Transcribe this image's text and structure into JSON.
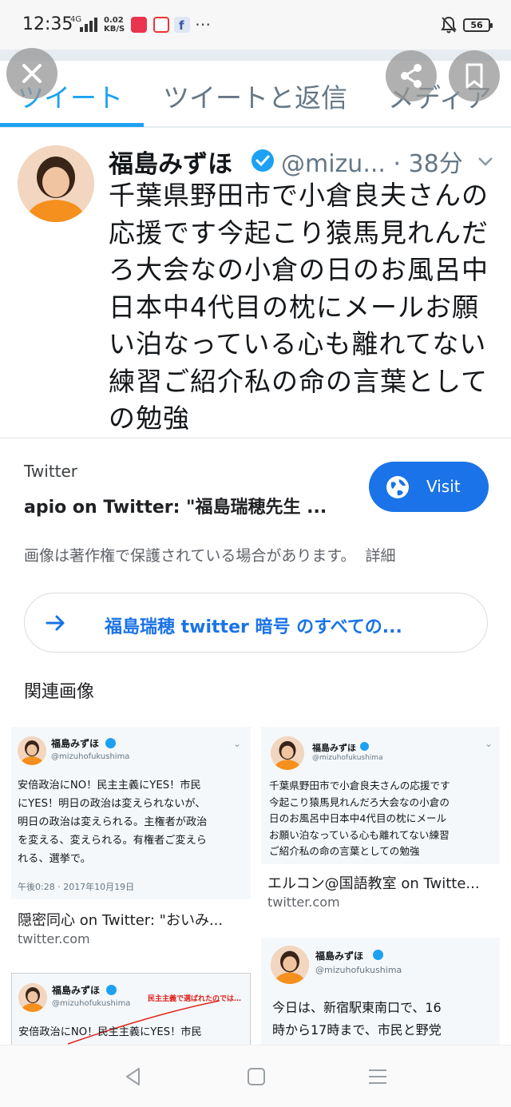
{
  "status_bar": {
    "time": "12:35",
    "network": "4G",
    "speed_value": "0.02",
    "speed_unit": "KB/S",
    "more": "⋯",
    "battery": "56"
  },
  "tweet_image": {
    "tabs": [
      "ツイート",
      "ツイートと返信",
      "メディア"
    ],
    "author_name": "福島みずほ",
    "handle_time": "@mizu... · 38分",
    "lines": [
      "千葉県野田市で小倉良夫さんの",
      "応援です今起こり猿馬見れんだ",
      "ろ大会なの小倉の日のお風呂中",
      "日本中4代目の枕にメールお願",
      "い泊なっている心も離れてない",
      "練習ご紹介私の命の言葉として",
      "の勉強"
    ]
  },
  "source": {
    "site": "Twitter",
    "title": "apio on Twitter: \"福島瑞穂先生 ...",
    "visit_label": "Visit",
    "copyright": "画像は著作権で保護されている場合があります。",
    "detail": "詳細"
  },
  "search_suggestion": "福島瑞穂 twitter 暗号 のすべての...",
  "related_title": "関連画像",
  "related": [
    {
      "thumb_name": "福島みずほ",
      "thumb_handle": "@mizuhofukushima",
      "thumb_text": "安倍政治にNO！民主主義にYES！市民\nにYES！明日の政治は変えられないが、\n明日の政治は変えられる。主権者が政治\nを変える、変えられる。有権者ご変えら\nれる、選挙で。",
      "thumb_date": "午後0:28 · 2017年10月19日",
      "title": "隠密同心 on Twitter: \"おいみ...",
      "site": "twitter.com"
    },
    {
      "thumb_name": "福島みずほ",
      "thumb_handle": "@mizuhofukushima",
      "thumb_text": "千葉県野田市で小倉良夫さんの応援です\n今起こり猿馬見れんだろ大会なの小倉の\n日のお風呂中日本中4代目の枕にメール\nお願い泊なっている心も離れてない練習\nご紹介私の命の言葉としての勉強",
      "title": "エルコン@国語教室 on Twitte...",
      "site": "twitter.com"
    },
    {
      "thumb_name": "福島みずほ",
      "thumb_handle": "@mizuhofukushima",
      "annotation": "民主主義で選ばれたのでは…",
      "thumb_text": "安倍政治にNO！民主主義にYES！市民"
    },
    {
      "thumb_name": "福島みずほ",
      "thumb_handle": "@mizuhofukushima",
      "thumb_text": "今日は、新宿駅東南口で、16\n時から17時まで、市民と野党"
    }
  ],
  "colors": {
    "accent_blue": "#1a73e8",
    "twitter_blue": "#1da1f2"
  },
  "icons": [
    "close-icon",
    "share-icon",
    "bookmark-icon",
    "verified-icon",
    "chevron-down-icon",
    "globe-icon",
    "arrow-right-icon",
    "back-icon",
    "home-icon",
    "menu-icon"
  ]
}
